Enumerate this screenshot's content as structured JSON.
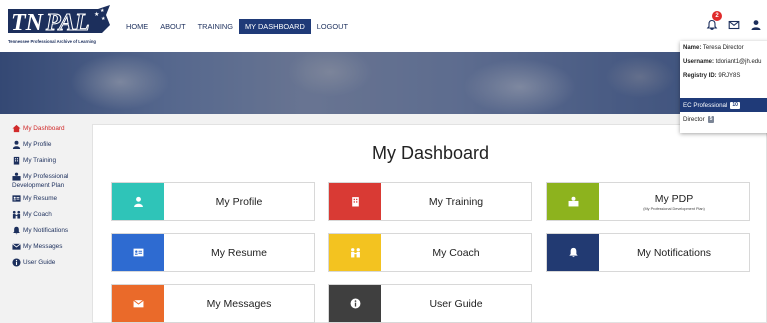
{
  "header": {
    "logo_text": "TNPAL",
    "logo_tagline": "Tennessee Professional Archive of Learning",
    "nav": [
      {
        "label": "HOME"
      },
      {
        "label": "ABOUT"
      },
      {
        "label": "TRAINING"
      },
      {
        "label": "MY DASHBOARD",
        "active": true
      },
      {
        "label": "LOGOUT"
      }
    ],
    "notification_count": "2",
    "icons": [
      "bell-icon",
      "mail-icon",
      "user-icon"
    ]
  },
  "user_menu": {
    "name_label": "Name:",
    "name": "Teresa Director",
    "username_label": "Username:",
    "username": "tdoriant1@jh.edu",
    "registry_label": "Registry ID:",
    "registry": "9RJY8S",
    "roles": [
      {
        "label": "EC Professional",
        "count": "10",
        "active": true
      },
      {
        "label": "Director",
        "count": "5",
        "active": false
      }
    ]
  },
  "sidebar": {
    "items": [
      {
        "label": "My Dashboard",
        "icon": "dashboard-icon",
        "active": true
      },
      {
        "label": "My Profile",
        "icon": "person-icon"
      },
      {
        "label": "My Training",
        "icon": "training-icon"
      },
      {
        "label": "My Professional Development Plan",
        "line1": "My Professional",
        "line2": "Development Plan",
        "icon": "pdp-icon"
      },
      {
        "label": "My Resume",
        "icon": "resume-icon"
      },
      {
        "label": "My Coach",
        "icon": "coach-icon"
      },
      {
        "label": "My Notifications",
        "icon": "bell-icon"
      },
      {
        "label": "My Messages",
        "icon": "envelope-icon"
      },
      {
        "label": "User Guide",
        "icon": "info-icon"
      }
    ]
  },
  "main": {
    "title": "My Dashboard",
    "cards": [
      {
        "label": "My Profile",
        "color": "#2fc4b8",
        "icon": "person-icon"
      },
      {
        "label": "My Training",
        "color": "#d93a34",
        "icon": "training-icon"
      },
      {
        "label": "My PDP",
        "sub": "(My Professional Development Plan)",
        "color": "#8db31e",
        "icon": "pdp-icon"
      },
      {
        "label": "My Resume",
        "color": "#2e6bd1",
        "icon": "resume-icon"
      },
      {
        "label": "My Coach",
        "color": "#f3c320",
        "icon": "coach-icon"
      },
      {
        "label": "My Notifications",
        "color": "#223a72",
        "icon": "bell-icon"
      },
      {
        "label": "My Messages",
        "color": "#ea6a2a",
        "icon": "envelope-icon"
      },
      {
        "label": "User Guide",
        "color": "#3f3f3f",
        "icon": "info-icon"
      }
    ]
  }
}
